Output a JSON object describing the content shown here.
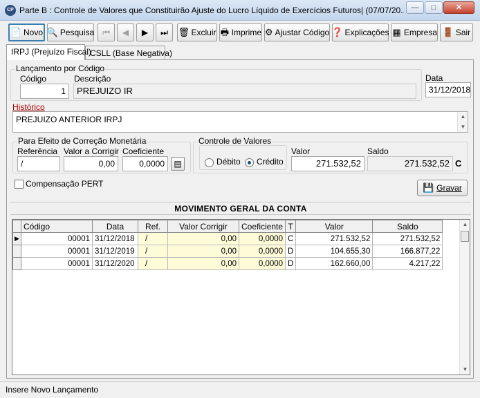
{
  "window": {
    "title": "Parte B : Controle de Valores que Constituirão Ajuste do Lucro Líquido de Exercícios Futuros| (07/07/20...",
    "app_icon_text": "CP",
    "controls": {
      "minimize": "—",
      "maximize": "□",
      "close": "✕"
    }
  },
  "toolbar": {
    "novo": "Novo",
    "pesquisa": "Pesquisa",
    "first": "⏮",
    "prev": "◀",
    "next": "▶",
    "last": "⏭",
    "excluir": "Excluir",
    "imprime": "Imprime",
    "ajustar_codigo": "Ajustar Código",
    "explicacoes": "Explicações",
    "empresa": "Empresa",
    "sair": "Sair"
  },
  "tabs": [
    "IRPJ (Prejuízo Fiscal)",
    "CSLL (Base Negativa)"
  ],
  "lancamento": {
    "group_label": "Lançamento por Código",
    "codigo_label": "Código",
    "codigo_value": "1",
    "descricao_label": "Descrição",
    "descricao_value": "PREJUIZO IR",
    "data_label": "Data",
    "data_value": "31/12/2018"
  },
  "historico": {
    "label": "Histórico",
    "value": "PREJUIZO ANTERIOR IRPJ"
  },
  "correcao": {
    "group_label": "Para Efeito de Correção Monetária",
    "referencia_label": "Referência",
    "referencia_value": " /",
    "valor_corrigir_label": "Valor a Corrigir",
    "valor_corrigir_value": "0,00",
    "coeficiente_label": "Coeficiente",
    "coeficiente_value": "0,0000"
  },
  "controle": {
    "group_label": "Controle de Valores",
    "debito_label": "Débito",
    "credito_label": "Crédito",
    "selected": "credito",
    "valor_label": "Valor",
    "valor_value": "271.532,52",
    "saldo_label": "Saldo",
    "saldo_value": "271.532,52",
    "saldo_indicator": "C"
  },
  "pert": {
    "label": "Compensação PERT",
    "checked": false
  },
  "gravar_label": "Gravar",
  "movimento": {
    "title": "MOVIMENTO GERAL DA CONTA",
    "columns": [
      "Código",
      "Data",
      "Ref.",
      "Valor Corrigir",
      "Coeficiente",
      "T",
      "Valor",
      "Saldo"
    ],
    "rows": [
      [
        "00001",
        "31/12/2018",
        "/",
        "0,00",
        "0,0000",
        "C",
        "271.532,52",
        "271.532,52"
      ],
      [
        "00001",
        "31/12/2019",
        "/",
        "0,00",
        "0,0000",
        "D",
        "104.655,30",
        "166.877,22"
      ],
      [
        "00001",
        "31/12/2020",
        "/",
        "0,00",
        "0,0000",
        "D",
        "162.660,00",
        "4.217,22"
      ]
    ]
  },
  "status": "Insere Novo Lançamento",
  "colors": {
    "highlight_cell": "#fefbd8",
    "label_red": "#b00000",
    "radio_dot": "#1c4a86"
  }
}
